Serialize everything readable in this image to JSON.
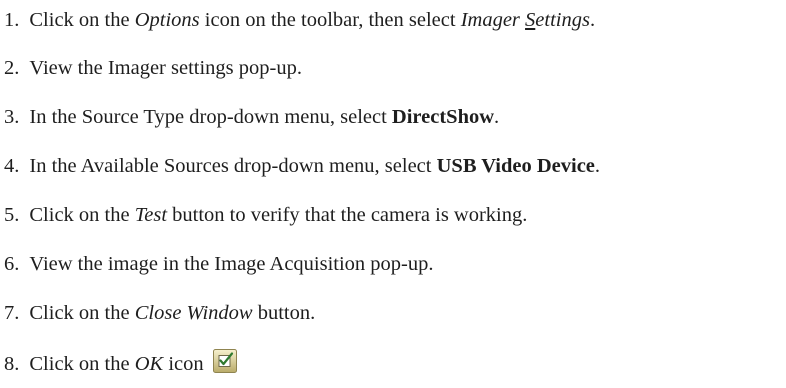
{
  "steps": [
    {
      "number": "1",
      "parts": {
        "a": "Click on the ",
        "b": "Options",
        "c": " icon on the toolbar, then select ",
        "d": "Imager ",
        "e": "S",
        "f": "ettings",
        "g": "."
      }
    },
    {
      "number": "2",
      "parts": {
        "a": "View the Imager settings pop-up."
      }
    },
    {
      "number": "3",
      "parts": {
        "a": "In the Source Type drop-down menu, select ",
        "b": "DirectShow",
        "c": "."
      }
    },
    {
      "number": "4",
      "parts": {
        "a": "In the Available Sources drop-down menu, select ",
        "b": "USB Video Device",
        "c": "."
      }
    },
    {
      "number": "5",
      "parts": {
        "a": "Click on the ",
        "b": "Test",
        "c": " button to verify that the camera is working."
      }
    },
    {
      "number": "6",
      "parts": {
        "a": "View the image in the Image Acquisition pop-up."
      }
    },
    {
      "number": "7",
      "parts": {
        "a": "Click on the ",
        "b": "Close Window",
        "c": " button."
      }
    },
    {
      "number": "8",
      "parts": {
        "a": "Click on the ",
        "b": "OK",
        "c": " icon"
      },
      "icon": "ok-checkbox-icon"
    }
  ]
}
